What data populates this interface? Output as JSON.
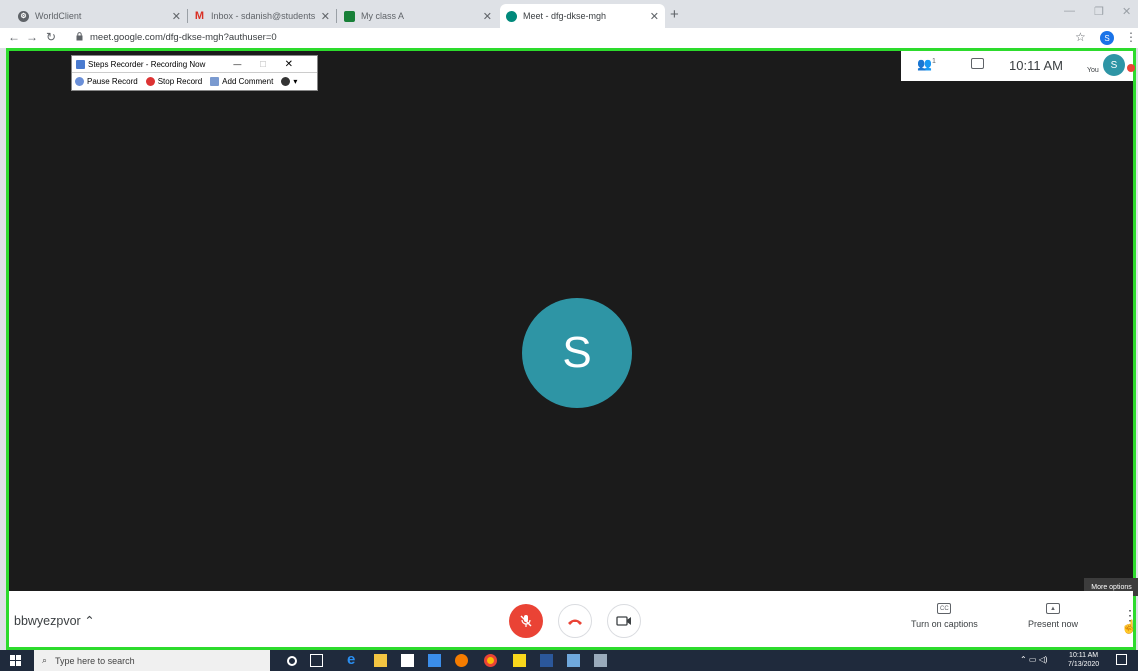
{
  "browser": {
    "tabs": [
      {
        "label": "WorldClient",
        "color": "#5f6368"
      },
      {
        "label": "Inbox - sdanish@students.au.ed",
        "color": "#d93025"
      },
      {
        "label": "My class A",
        "color": "#188038"
      },
      {
        "label": "Meet - dfg-dkse-mgh",
        "color": "#00897b"
      }
    ],
    "url": "meet.google.com/dfg-dkse-mgh?authuser=0",
    "profile_initial": "S"
  },
  "steps_recorder": {
    "title": "Steps Recorder - Recording Now",
    "pause": "Pause Record",
    "stop": "Stop Record",
    "comment": "Add Comment"
  },
  "meet": {
    "time": "10:11 AM",
    "you_label": "You",
    "you_initial": "S",
    "participant_count": "1",
    "center_initial": "S",
    "meeting_code": "bbwyezpvor",
    "tooltip": "More options",
    "captions_label": "Turn on captions",
    "present_label": "Present now",
    "cc_text": "CC"
  },
  "taskbar": {
    "search_placeholder": "Type here to search",
    "time": "10:11 AM",
    "date": "7/13/2020"
  },
  "colors": {
    "highlight": "#2ddb2d",
    "avatar": "#2e95a5",
    "hangup": "#ea4335"
  }
}
